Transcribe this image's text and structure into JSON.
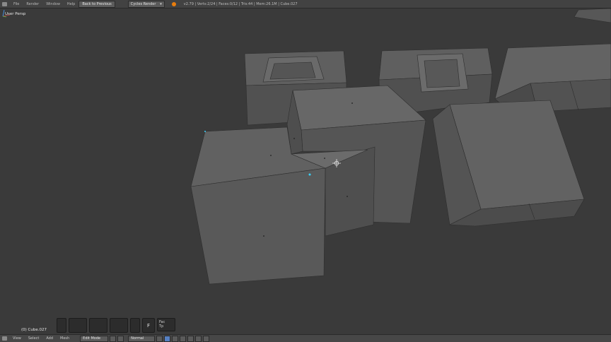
{
  "topbar": {
    "menus": [
      "File",
      "Render",
      "Window",
      "Help"
    ],
    "back_button": "Back to Previous",
    "render_engine": "Cycles Render",
    "stats": "v2.79 | Verts:2/24 | Faces:0/12 | Tris:44 | Mem:26.1M | Cube.027"
  },
  "viewport": {
    "view_label": "User Persp",
    "object_label": "(0) Cube.027"
  },
  "toolshelf": {
    "f_label": "F",
    "last_op_line1": "Fac",
    "last_op_line2": "Tp"
  },
  "bottombar": {
    "menus": [
      "View",
      "Select",
      "Add",
      "Mesh"
    ],
    "mode": "Edit Mode",
    "pivot": "Normal"
  },
  "colors": {
    "background": "#3a3a3a",
    "accent_orange": "#e87d0d",
    "select_blue": "#5680c2",
    "vertex_cyan": "#39d3ff"
  },
  "icons": {
    "editor_type": "view3d-icon",
    "logo": "blender-logo-icon",
    "cursor": "3d-cursor-icon",
    "axes": "axes-gizmo-icon"
  }
}
